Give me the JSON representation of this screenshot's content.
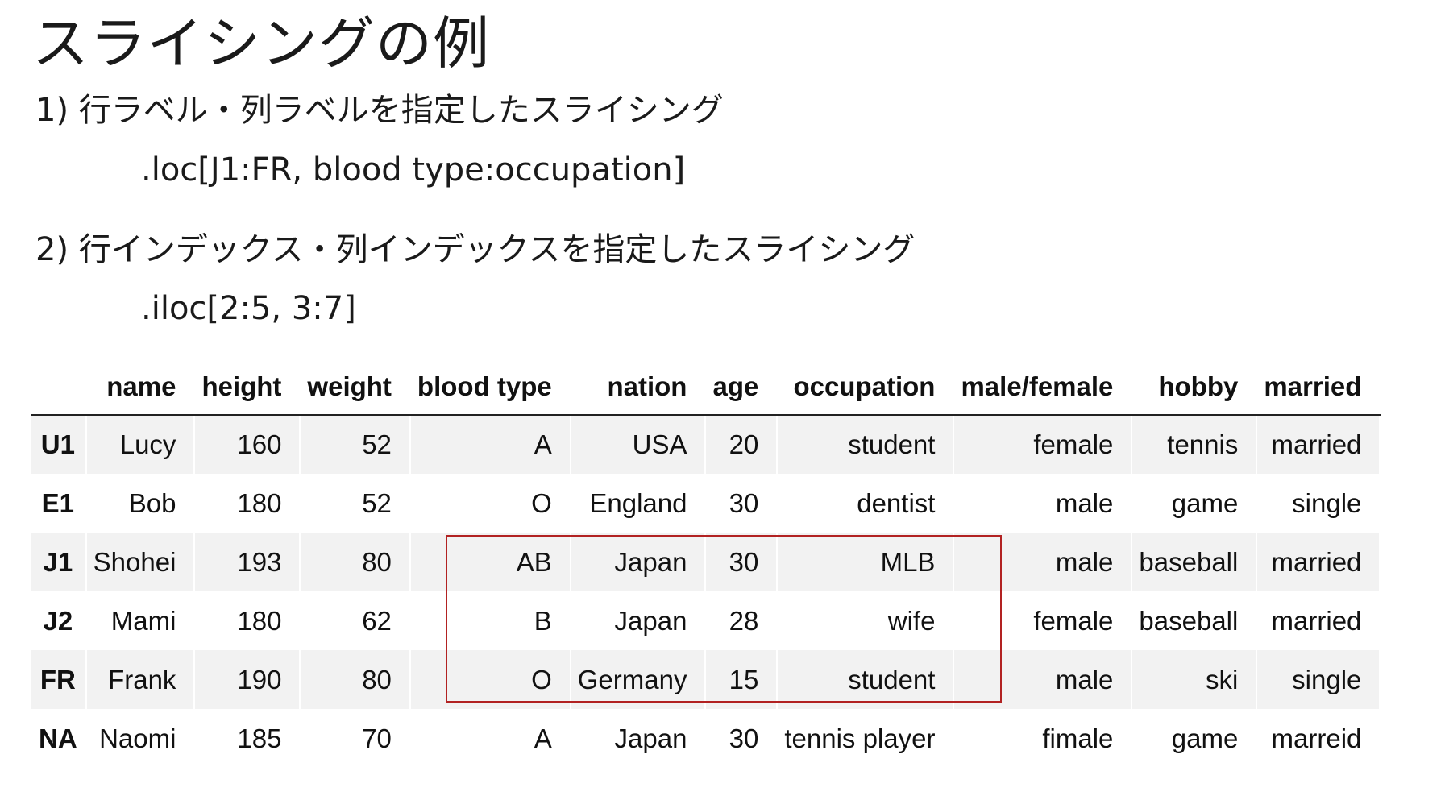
{
  "title": "スライシングの例",
  "section1": {
    "heading": "1) 行ラベル・列ラベルを指定したスライシング",
    "code": ".loc[J1:FR, blood type:occupation]"
  },
  "section2": {
    "heading": "2) 行インデックス・列インデックスを指定したスライシング",
    "code": ".iloc[2:5, 3:7]"
  },
  "table": {
    "columns": [
      "",
      "name",
      "height",
      "weight",
      "blood type",
      "nation",
      "age",
      "occupation",
      "male/female",
      "hobby",
      "married"
    ],
    "rows": [
      {
        "index": "U1",
        "cells": [
          "Lucy",
          "160",
          "52",
          "A",
          "USA",
          "20",
          "student",
          "female",
          "tennis",
          "married"
        ]
      },
      {
        "index": "E1",
        "cells": [
          "Bob",
          "180",
          "52",
          "O",
          "England",
          "30",
          "dentist",
          "male",
          "game",
          "single"
        ]
      },
      {
        "index": "J1",
        "cells": [
          "Shohei",
          "193",
          "80",
          "AB",
          "Japan",
          "30",
          "MLB",
          "male",
          "baseball",
          "married"
        ]
      },
      {
        "index": "J2",
        "cells": [
          "Mami",
          "180",
          "62",
          "B",
          "Japan",
          "28",
          "wife",
          "female",
          "baseball",
          "married"
        ]
      },
      {
        "index": "FR",
        "cells": [
          "Frank",
          "190",
          "80",
          "O",
          "Germany",
          "15",
          "student",
          "male",
          "ski",
          "single"
        ]
      },
      {
        "index": "NA",
        "cells": [
          "Naomi",
          "185",
          "70",
          "A",
          "Japan",
          "30",
          "tennis player",
          "fimale",
          "game",
          "marreid"
        ]
      }
    ]
  },
  "highlight_color": "#b22222"
}
